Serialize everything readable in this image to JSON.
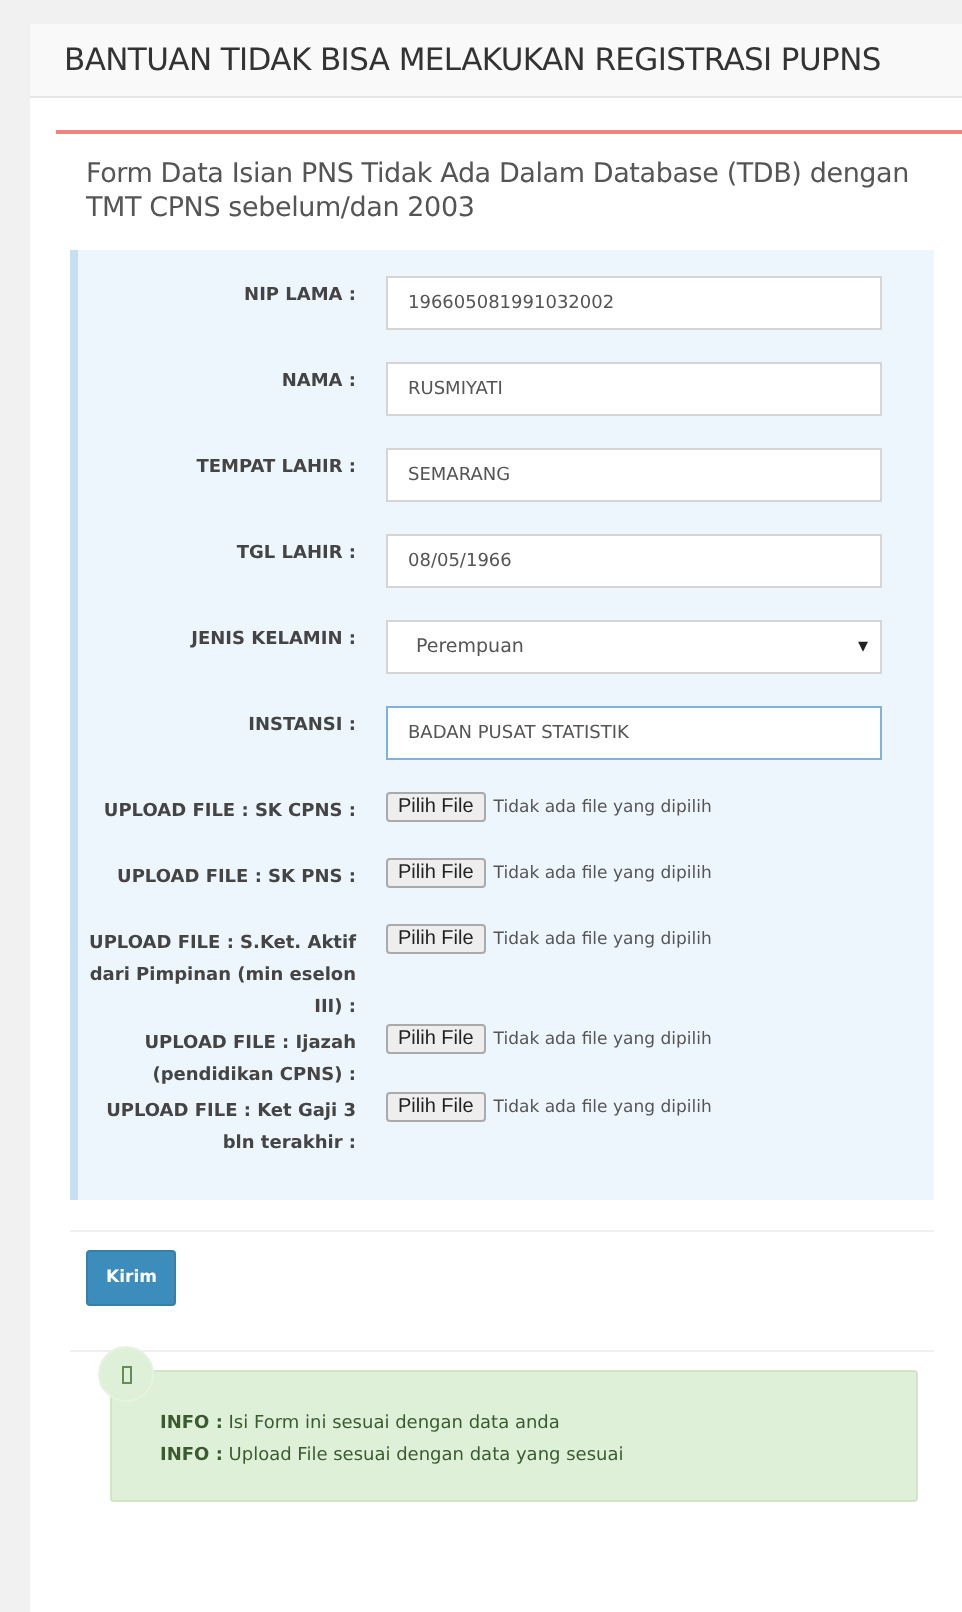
{
  "page_title": "BANTUAN TIDAK BISA MELAKUKAN REGISTRASI PUPNS",
  "card_title": "Form Data Isian PNS Tidak Ada Dalam Database (TDB) dengan TMT CPNS sebelum/dan 2003",
  "fields": [
    {
      "kind": "text",
      "label": "NIP LAMA :",
      "value": "196605081991032002",
      "focused": false
    },
    {
      "kind": "text",
      "label": "NAMA :",
      "value": "RUSMIYATI",
      "focused": false
    },
    {
      "kind": "text",
      "label": "TEMPAT LAHIR :",
      "value": "SEMARANG",
      "focused": false
    },
    {
      "kind": "text",
      "label": "TGL LAHIR :",
      "value": "08/05/1966",
      "focused": false
    },
    {
      "kind": "select",
      "label": "JENIS KELAMIN :",
      "value": "Perempuan",
      "arrow": "▾",
      "focused": false
    },
    {
      "kind": "text",
      "label": "INSTANSI :",
      "value": "BADAN PUSAT STATISTIK",
      "focused": true
    },
    {
      "kind": "file",
      "label": "UPLOAD FILE : SK CPNS :",
      "button": "Pilih File",
      "status": "Tidak ada file yang dipilih"
    },
    {
      "kind": "file",
      "label": "UPLOAD FILE : SK PNS :",
      "button": "Pilih File",
      "status": "Tidak ada file yang dipilih"
    },
    {
      "kind": "file",
      "label": "UPLOAD FILE : S.Ket. Aktif dari Pimpinan (min eselon III) :",
      "button": "Pilih File",
      "status": "Tidak ada file yang dipilih"
    },
    {
      "kind": "file",
      "label": "UPLOAD FILE : Ijazah (pendidikan CPNS) :",
      "button": "Pilih File",
      "status": "Tidak ada file yang dipilih"
    },
    {
      "kind": "file",
      "label": "UPLOAD FILE : Ket Gaji 3 bln terakhir :",
      "button": "Pilih File",
      "status": "Tidak ada file yang dipilih"
    }
  ],
  "submit_button": "Kirim",
  "info": [
    "**INFO :** Isi Form ini sesuai dengan data anda",
    "**INFO :** Upload File sesuai dengan data yang sesuai"
  ]
}
